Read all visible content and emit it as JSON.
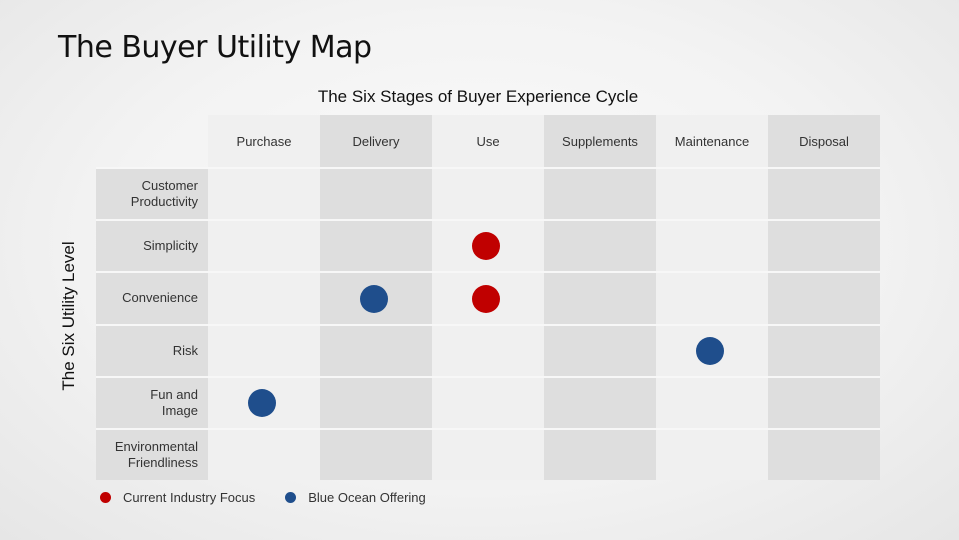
{
  "title": "The Buyer Utility Map",
  "subtitle": "The Six Stages of Buyer Experience Cycle",
  "y_axis_label": "The Six Utility Level",
  "stages": [
    "Purchase",
    "Delivery",
    "Use",
    "Supplements",
    "Maintenance",
    "Disposal"
  ],
  "levels": [
    "Customer\nProductivity",
    "Simplicity",
    "Convenience",
    "Risk",
    "Fun and\nImage",
    "Environmental\nFriendliness"
  ],
  "colors": {
    "current": "#c00000",
    "blue_ocean": "#1f4e8c"
  },
  "markers": [
    {
      "stage": "Use",
      "level": "Simplicity",
      "type": "current"
    },
    {
      "stage": "Use",
      "level": "Convenience",
      "type": "current"
    },
    {
      "stage": "Delivery",
      "level": "Convenience",
      "type": "blue_ocean"
    },
    {
      "stage": "Maintenance",
      "level": "Risk",
      "type": "blue_ocean"
    },
    {
      "stage": "Purchase",
      "level": "Fun and Image",
      "type": "blue_ocean"
    }
  ],
  "legend": [
    {
      "label": "Current Industry Focus",
      "type": "current"
    },
    {
      "label": "Blue Ocean Offering",
      "type": "blue_ocean"
    }
  ]
}
